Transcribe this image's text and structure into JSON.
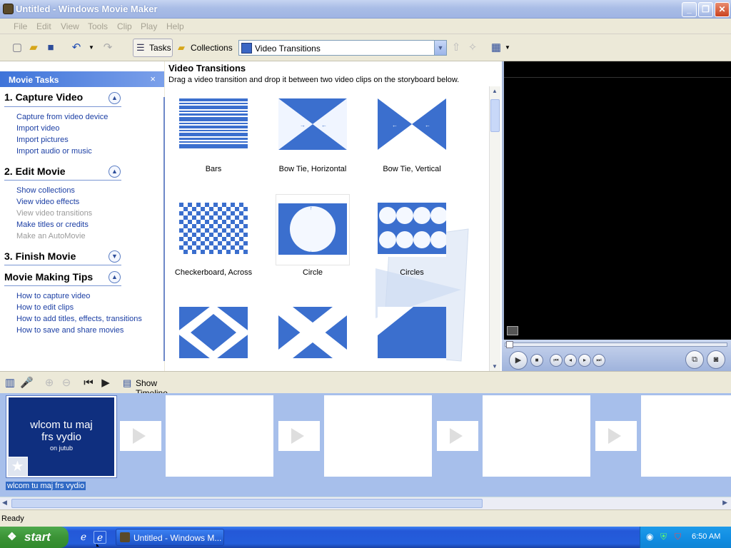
{
  "window": {
    "title": "Untitled - Windows Movie Maker",
    "min": "_",
    "max": "❐",
    "close": "✕"
  },
  "menu": [
    "File",
    "Edit",
    "View",
    "Tools",
    "Clip",
    "Play",
    "Help"
  ],
  "toolbar": {
    "tasks": "Tasks",
    "collections": "Collections",
    "location": "Video Transitions"
  },
  "task_pane": {
    "header": "Movie Tasks",
    "close": "×",
    "sections": [
      {
        "title": "1. Capture Video",
        "expanded": true,
        "items": [
          {
            "label": "Capture from video device"
          },
          {
            "label": "Import video"
          },
          {
            "label": "Import pictures"
          },
          {
            "label": "Import audio or music"
          }
        ]
      },
      {
        "title": "2. Edit Movie",
        "expanded": true,
        "items": [
          {
            "label": "Show collections"
          },
          {
            "label": "View video effects"
          },
          {
            "label": "View video transitions",
            "disabled": true
          },
          {
            "label": "Make titles or credits"
          },
          {
            "label": "Make an AutoMovie",
            "disabled": true
          }
        ]
      },
      {
        "title": "3. Finish Movie",
        "expanded": false,
        "items": []
      },
      {
        "title": "Movie Making Tips",
        "expanded": true,
        "items": [
          {
            "label": "How to capture video"
          },
          {
            "label": "How to edit clips"
          },
          {
            "label": "How to add titles, effects, transitions"
          },
          {
            "label": "How to save and share movies"
          }
        ]
      }
    ]
  },
  "content": {
    "title": "Video Transitions",
    "description": "Drag a video transition and drop it between two video clips on the storyboard below.",
    "transitions": [
      {
        "label": "Bars",
        "icon": "bars"
      },
      {
        "label": "Bow Tie, Horizontal",
        "icon": "bowtie-h"
      },
      {
        "label": "Bow Tie, Vertical",
        "icon": "bowtie-v"
      },
      {
        "label": "Checkerboard, Across",
        "icon": "checker"
      },
      {
        "label": "Circle",
        "icon": "circle",
        "selected": true
      },
      {
        "label": "Circles",
        "icon": "circles"
      },
      {
        "label": "",
        "icon": "diamond"
      },
      {
        "label": "",
        "icon": "x-shape"
      },
      {
        "label": "",
        "icon": "diagonal"
      }
    ]
  },
  "storyboard": {
    "show_timeline": "Show Timeline",
    "clip_line1": "wlcom tu maj",
    "clip_line2": "frs vydio",
    "clip_sub": "on jutub",
    "clip_label": "wlcom tu maj frs vydio"
  },
  "status": "Ready",
  "taskbar": {
    "start": "start",
    "task": "Untitled - Windows M...",
    "time": "6:50 AM"
  }
}
